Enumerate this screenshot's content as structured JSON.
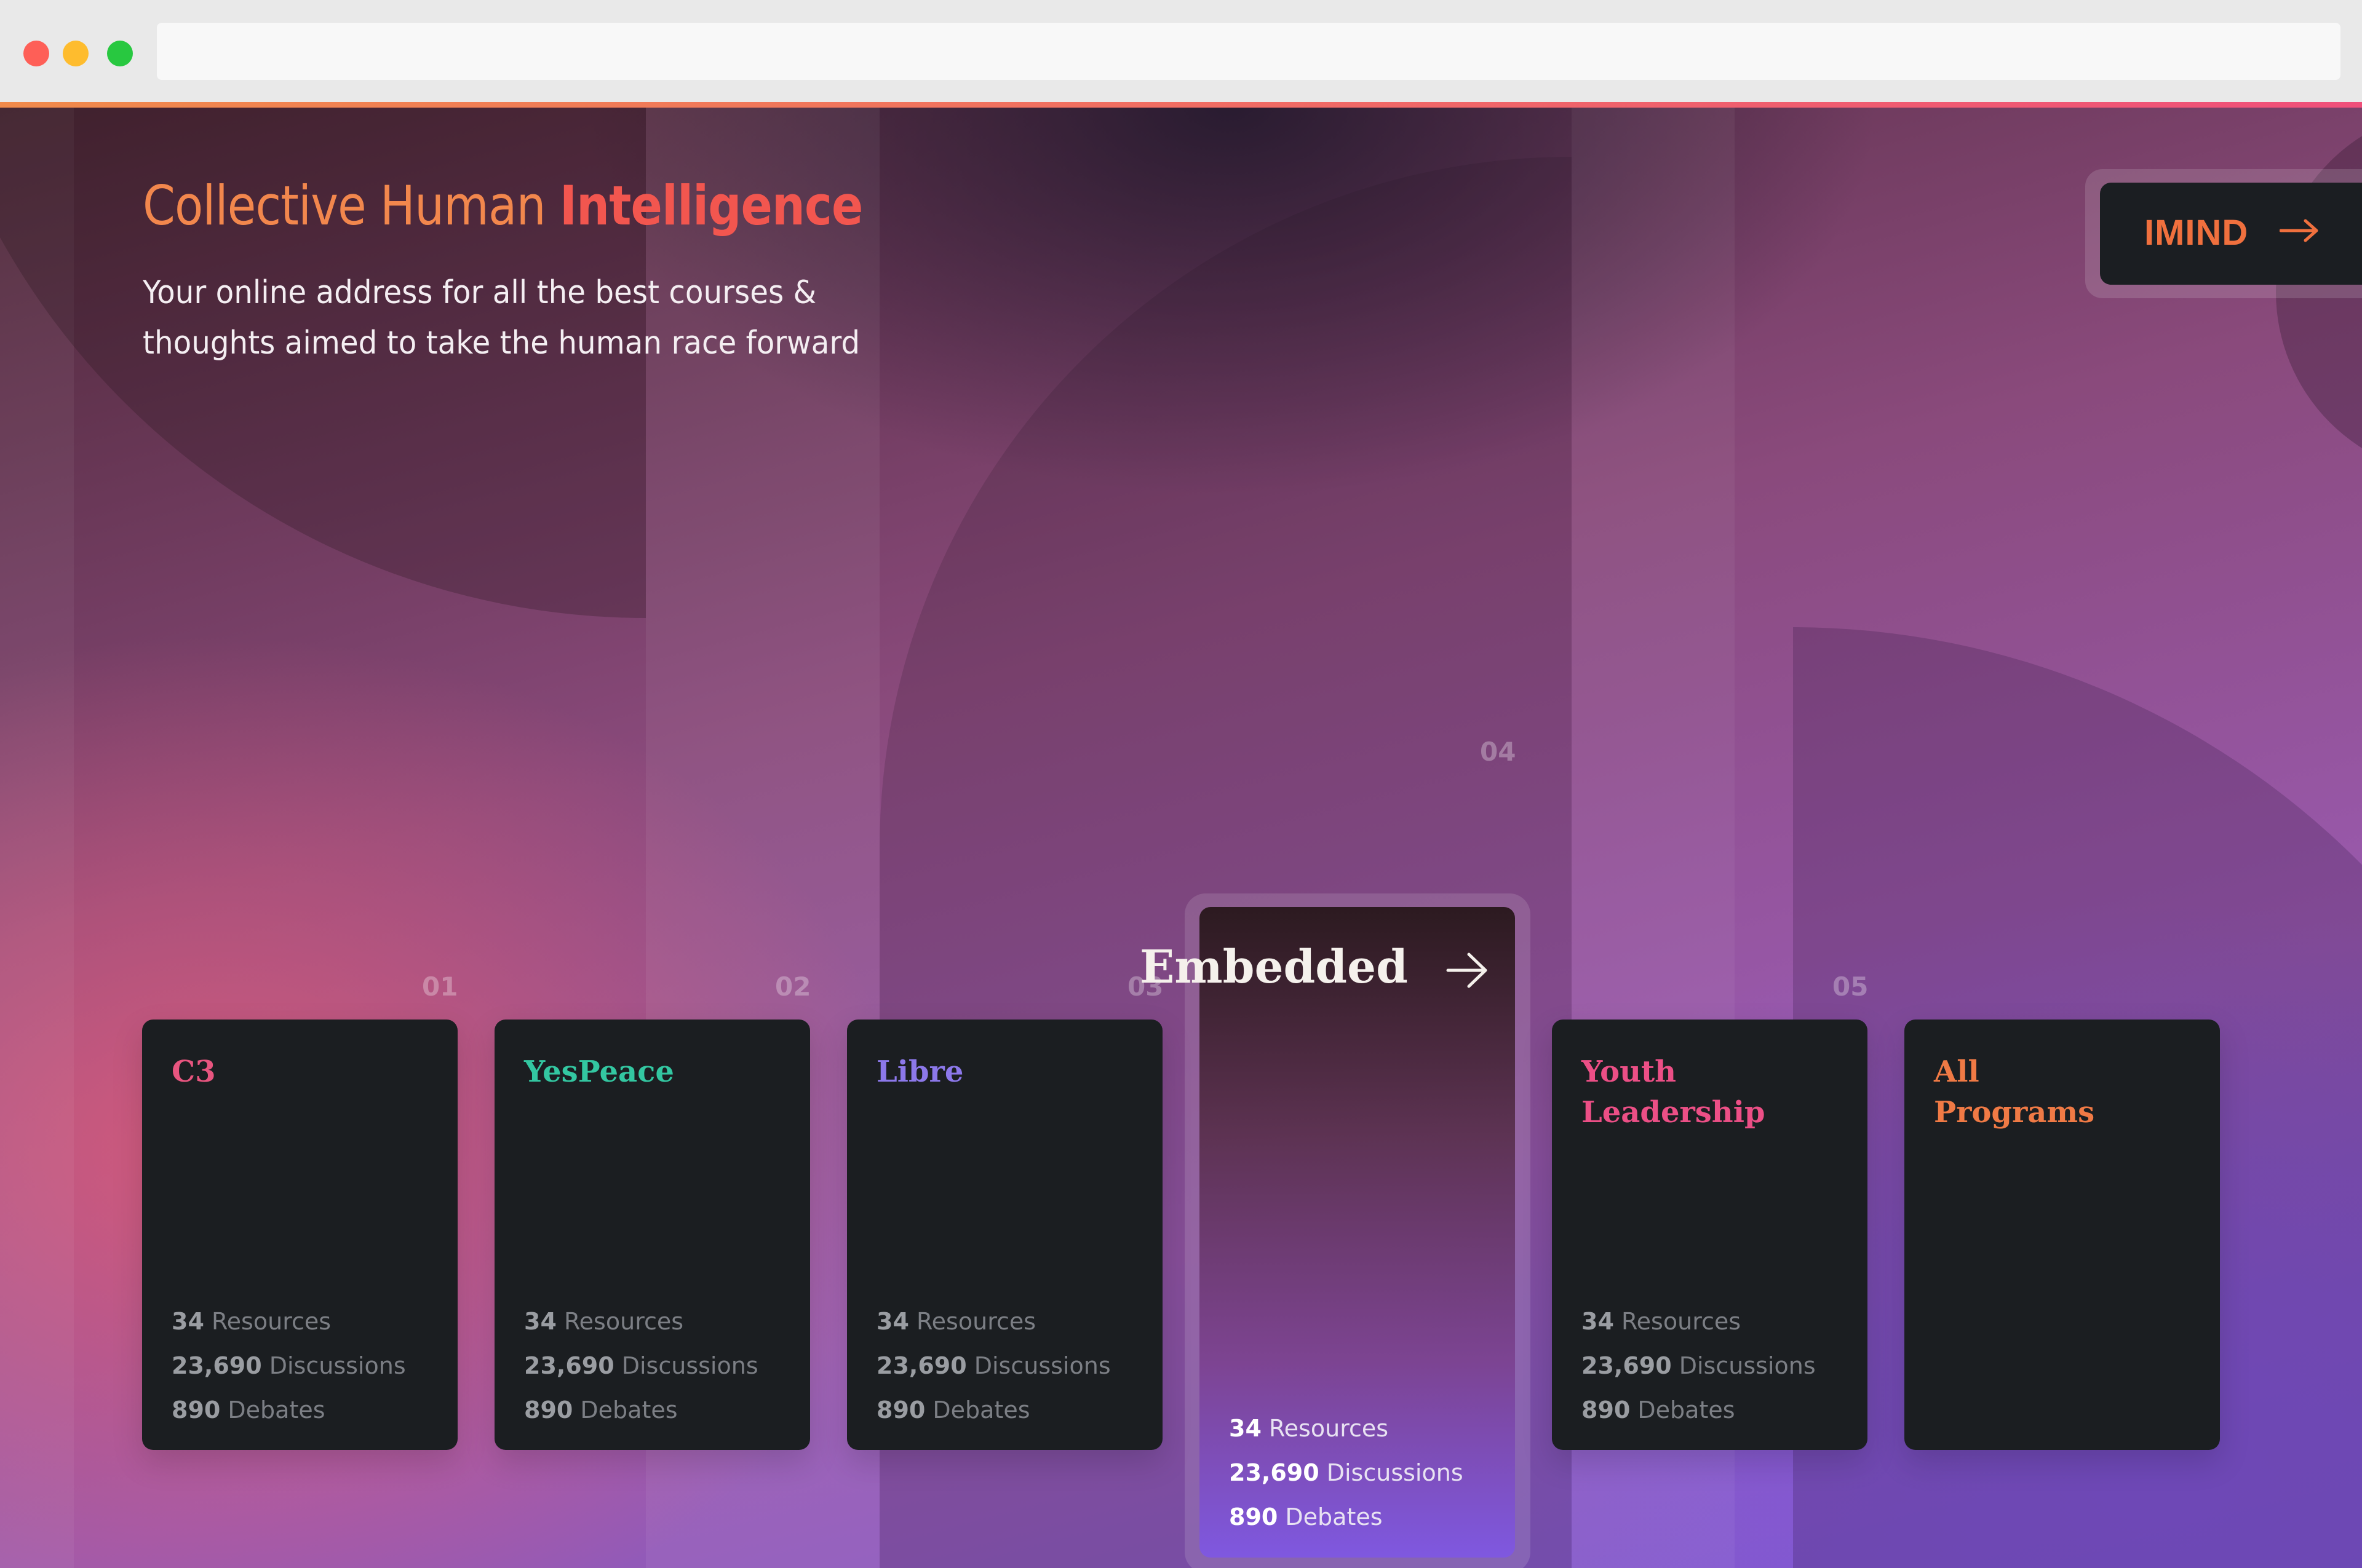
{
  "hero": {
    "title_part1": "Collective",
    "title_part2": "Human",
    "title_part3": "Intelligence",
    "subtitle": "Your online address for all the best courses & thoughts aimed to take the human race forward"
  },
  "cta": {
    "label": "IMIND",
    "icon": "arrow-right-icon"
  },
  "colors": {
    "accent_orange": "#f2874d",
    "accent_red": "#f2564f",
    "card_bg": "#1b1e21",
    "c3": "#e8557f",
    "yespeace": "#33c7a1",
    "libre": "#8c78ea",
    "youth": "#ec4f86",
    "all": "#f07a45"
  },
  "programs": [
    {
      "num": "01",
      "name": "C3",
      "resources": "34",
      "resources_label": "Resources",
      "discussions": "23,690",
      "discussions_label": "Discussions",
      "debates": "890",
      "debates_label": "Debates"
    },
    {
      "num": "02",
      "name": "YesPeace",
      "resources": "34",
      "resources_label": "Resources",
      "discussions": "23,690",
      "discussions_label": "Discussions",
      "debates": "890",
      "debates_label": "Debates"
    },
    {
      "num": "03",
      "name": "Libre",
      "resources": "34",
      "resources_label": "Resources",
      "discussions": "23,690",
      "discussions_label": "Discussions",
      "debates": "890",
      "debates_label": "Debates"
    },
    {
      "num": "04",
      "name": "Embedded",
      "resources": "34",
      "resources_label": "Resources",
      "discussions": "23,690",
      "discussions_label": "Discussions",
      "debates": "890",
      "debates_label": "Debates"
    },
    {
      "num": "05",
      "name": "Youth Leadership",
      "resources": "34",
      "resources_label": "Resources",
      "discussions": "23,690",
      "discussions_label": "Discussions",
      "debates": "890",
      "debates_label": "Debates"
    },
    {
      "name": "All Programs"
    }
  ]
}
